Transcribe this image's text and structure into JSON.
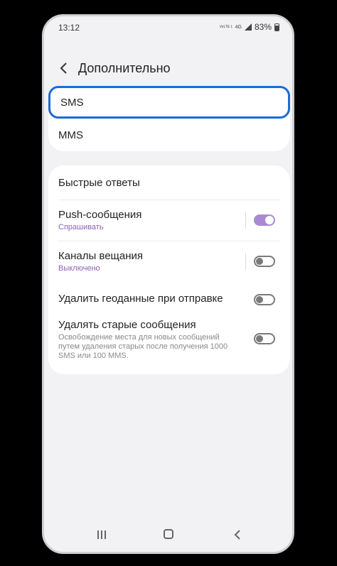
{
  "status": {
    "time": "13:12",
    "net_top": "VoLTE LTE1",
    "net_4g": "4G",
    "battery": "83%"
  },
  "header": {
    "title": "Дополнительно",
    "back_icon": "chevron-left-icon"
  },
  "card1": {
    "sms_label": "SMS",
    "mms_label": "MMS"
  },
  "card2": {
    "quick_replies": "Быстрые ответы",
    "push": {
      "label": "Push-сообщения",
      "sub": "Спрашивать",
      "state": "on"
    },
    "broadcast": {
      "label": "Каналы вещания",
      "sub": "Выключено",
      "state": "off"
    },
    "geodata": {
      "label": "Удалить геоданные при отправке",
      "state": "off"
    },
    "old_messages": {
      "label": "Удалять старые сообщения",
      "desc": "Освобождение места для новых сообщений путем удаления старых после получения 1000 SMS или 100 MMS.",
      "state": "off"
    }
  },
  "colors": {
    "accent": "#1b6cd8",
    "toggle_on": "#a98ad2",
    "sub_text": "#8a60b8"
  }
}
